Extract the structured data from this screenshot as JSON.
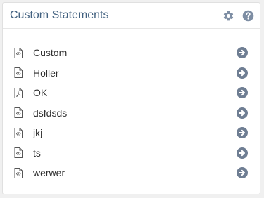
{
  "panel": {
    "title": "Custom Statements",
    "header_icons": [
      "gear-icon",
      "help-icon"
    ]
  },
  "statements": [
    {
      "name": "Custom",
      "icon": "code-file-icon"
    },
    {
      "name": "Holler",
      "icon": "code-file-icon"
    },
    {
      "name": "OK",
      "icon": "pdf-file-icon"
    },
    {
      "name": "dsfdsds",
      "icon": "code-file-icon"
    },
    {
      "name": "jkj",
      "icon": "code-file-icon"
    },
    {
      "name": "ts",
      "icon": "code-file-icon"
    },
    {
      "name": "werwer",
      "icon": "code-file-icon"
    }
  ],
  "colors": {
    "title": "#41607f",
    "header_icon": "#7e8ea4",
    "arrow_icon": "#6f7e93",
    "file_icon": "#555555"
  }
}
